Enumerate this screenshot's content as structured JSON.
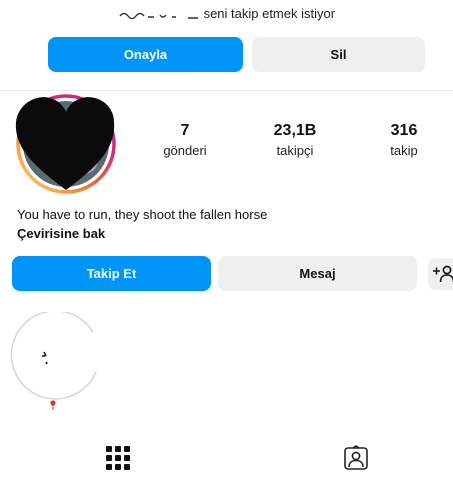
{
  "request": {
    "text": "seni takip etmek istiyor",
    "approve_label": "Onayla",
    "delete_label": "Sil"
  },
  "profile": {
    "stats": [
      {
        "value": "7",
        "label": "gönderi"
      },
      {
        "value": "23,1B",
        "label": "takipçi"
      },
      {
        "value": "316",
        "label": "takip"
      }
    ],
    "bio": "You have to run, they shoot the fallen horse",
    "translate_label": "Çevirisine bak"
  },
  "actions": {
    "follow_label": "Takip Et",
    "message_label": "Mesaj"
  },
  "colors": {
    "accent": "#0095f6",
    "secondary_bg": "#efefef"
  },
  "tabs": [
    {
      "icon": "grid-icon"
    },
    {
      "icon": "tagged-person-icon"
    }
  ]
}
